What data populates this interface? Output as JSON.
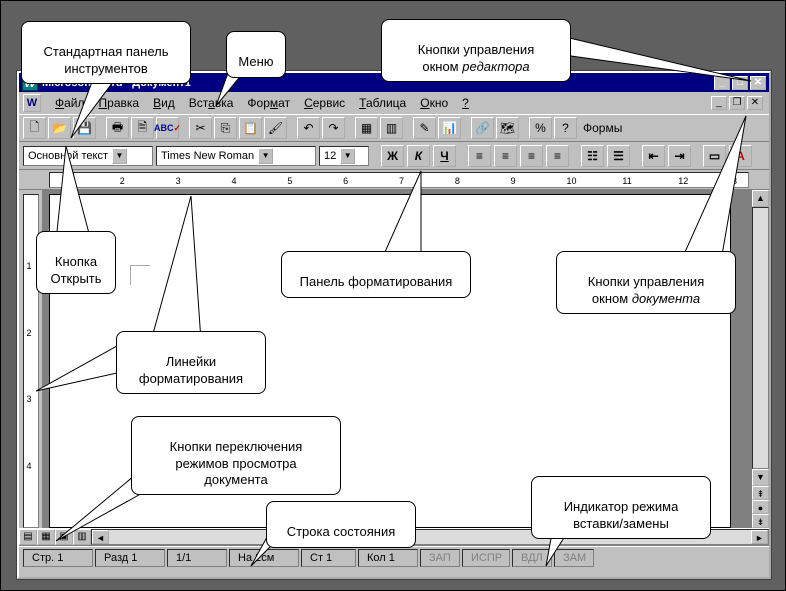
{
  "title": "Microsoft Word - Документ1",
  "menu": [
    "Файл",
    "Правка",
    "Вид",
    "Вставка",
    "Формат",
    "Сервис",
    "Таблица",
    "Окно",
    "?"
  ],
  "std_toolbar_right_label": "Формы",
  "fmt": {
    "style": "Основной текст",
    "font": "Times New Roman",
    "size": "12",
    "bold": "Ж",
    "italic": "К",
    "underline": "Ч"
  },
  "ruler_marks": [
    "1",
    "2",
    "3",
    "4",
    "5",
    "6",
    "7",
    "8",
    "9",
    "10",
    "11",
    "12",
    "13"
  ],
  "vruler_marks": [
    "1",
    "2",
    "3",
    "4"
  ],
  "status": {
    "page": "Стр. 1",
    "section": "Разд 1",
    "pages": "1/1",
    "at": "На 2см",
    "line": "Ст 1",
    "col": "Кол 1",
    "rec": "ЗАП",
    "trk": "ИСПР",
    "ext": "ВДЛ",
    "ovr": "ЗАМ"
  },
  "callouts": {
    "std_toolbar": "Стандартная панель\nинструментов",
    "menu": "Меню",
    "editor_btns": "Кнопки управления\nокном ",
    "editor_btns_em": "редактора",
    "open_btn": "Кнопка\nОткрыть",
    "fmt_panel": "Панель форматирования",
    "doc_btns": "Кнопки управления\nокном ",
    "doc_btns_em": "документа",
    "rulers": "Линейки\nформатирования",
    "viewmodes": "Кнопки переключения\nрежимов просмотра\nдокумента",
    "statusbar": "Строка состояния",
    "ovr": "Индикатор режима\nвставки/замены"
  }
}
